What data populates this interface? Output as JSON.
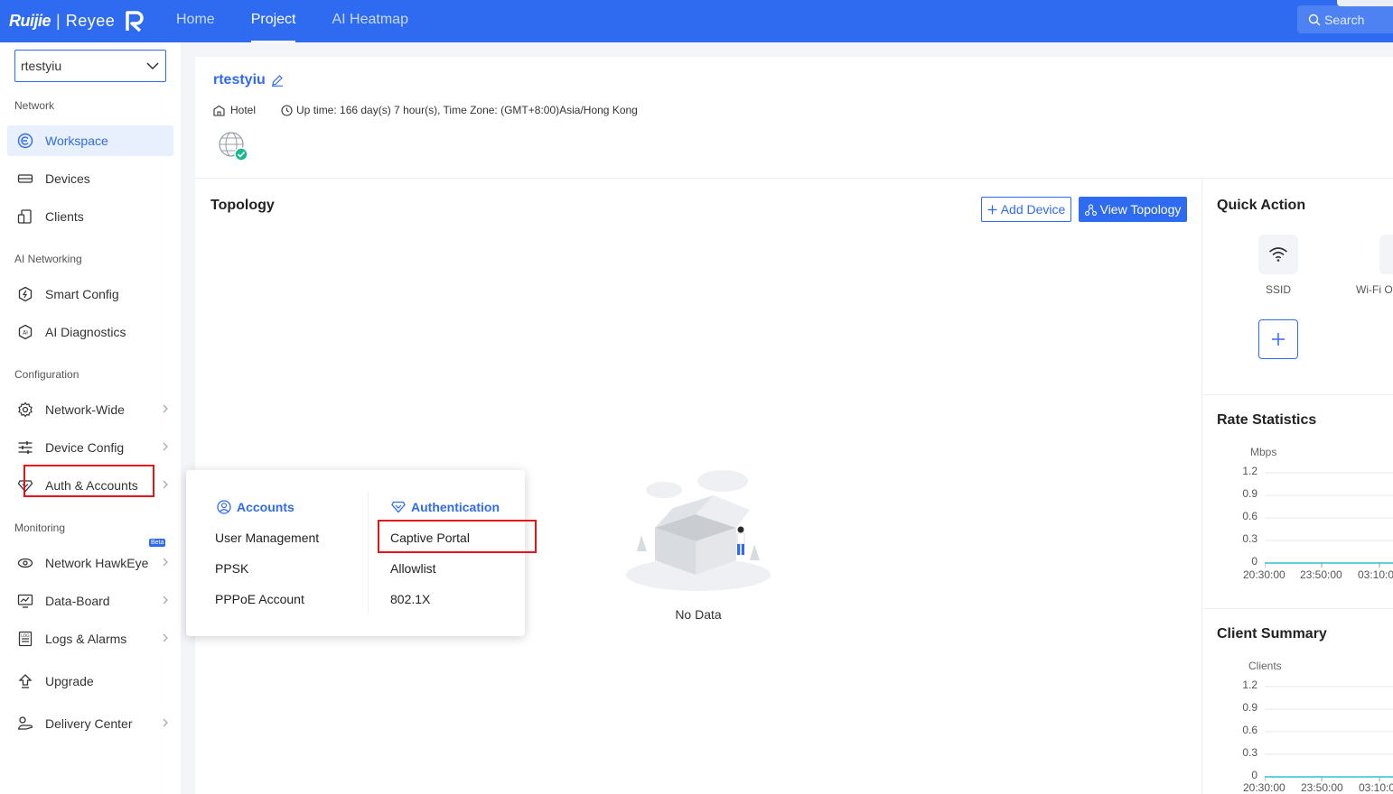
{
  "header": {
    "logo_brand1": "Ruijie",
    "logo_sep": "|",
    "logo_brand2": "Reyee",
    "nav": [
      "Home",
      "Project",
      "AI Heatmap"
    ],
    "active_nav": "Project",
    "search_label": "Search"
  },
  "sidebar": {
    "project_selected": "rtestyiu",
    "sections": {
      "network": "Network",
      "ai_networking": "AI Networking",
      "configuration": "Configuration",
      "monitoring": "Monitoring"
    },
    "items": {
      "workspace": "Workspace",
      "devices": "Devices",
      "clients": "Clients",
      "smart_config": "Smart Config",
      "ai_diagnostics": "AI Diagnostics",
      "network_wide": "Network-Wide",
      "device_config": "Device Config",
      "auth_accounts": "Auth & Accounts",
      "network_hawkeye": "Network HawkEye",
      "data_board": "Data-Board",
      "logs_alarms": "Logs & Alarms",
      "upgrade": "Upgrade",
      "delivery_center": "Delivery Center"
    },
    "beta_badge": "Beta"
  },
  "project": {
    "name": "rtestyiu",
    "scene": "Hotel",
    "uptime": "Up time: 166 day(s) 7 hour(s), Time Zone: (GMT+8:00)Asia/Hong Kong"
  },
  "topology": {
    "title": "Topology",
    "add_device": "Add Device",
    "view_topology": "View Topology",
    "empty": "No Data"
  },
  "quick_action": {
    "title": "Quick Action",
    "items": [
      "SSID",
      "Wi-Fi O"
    ]
  },
  "rate_statistics": {
    "title": "Rate Statistics",
    "unit": "Mbps",
    "yticks": [
      "1.2",
      "0.9",
      "0.6",
      "0.3",
      "0"
    ],
    "xticks": [
      "20:30:00",
      "23:50:00",
      "03:10:0"
    ]
  },
  "client_summary": {
    "title": "Client Summary",
    "unit": "Clients",
    "yticks": [
      "1.2",
      "0.9",
      "0.6",
      "0.3",
      "0"
    ],
    "xticks": [
      "20:30:00",
      "23:50:00",
      "03:10:0"
    ]
  },
  "flyout": {
    "accounts_title": "Accounts",
    "accounts_items": [
      "User Management",
      "PPSK",
      "PPPoE Account"
    ],
    "auth_title": "Authentication",
    "auth_items": [
      "Captive Portal",
      "Allowlist",
      "802.1X"
    ]
  },
  "colors": {
    "brand": "#2f6bf0",
    "highlight": "#e5141b",
    "chart_line": "#2ec4d6"
  }
}
